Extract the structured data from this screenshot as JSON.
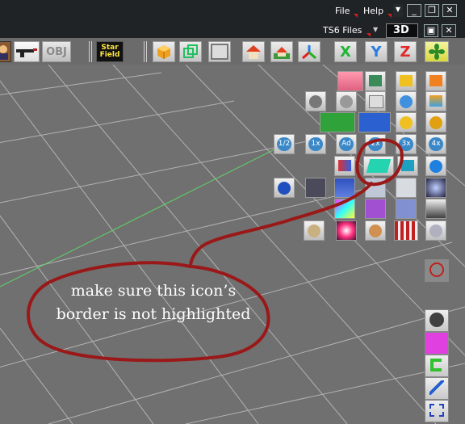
{
  "menubar": {
    "file_label": "File",
    "help_label": "Help",
    "files_dropdown": "TS6 Files",
    "view_mode": "3D"
  },
  "toolbar": {
    "obj_label": "OBJ",
    "starfield_label": "Star Field",
    "axis_labels": [
      "X",
      "Y",
      "Z"
    ]
  },
  "palette": {
    "rows": [
      {
        "icons": [
          "pink-arrow-icon",
          "p-cube-icon",
          "yellow-cubes-icon",
          "orange-cubes-icon"
        ]
      },
      {
        "icons": [
          "sphere-grid-icon",
          "cube-grid-icon",
          "cube-white-icon",
          "blue-sphere-icon",
          "gradient-cube-icon"
        ]
      },
      {
        "icons": [
          "green-shape-icon",
          "blue-shape-icon",
          "yellow-dome-icon",
          "torus-icon"
        ]
      },
      {
        "scale_labels": [
          "1/2",
          "1x",
          "Ad",
          "2x",
          "3x",
          "4x"
        ]
      },
      {
        "icons": [
          "shape-mix-icon",
          "teal-square-icon",
          "teal-cube-icon",
          "blue-sphere-ball-icon"
        ]
      },
      {
        "icons": [
          "no-sphere-icon",
          "swirl-icon",
          "blue-blob-icon",
          "cloud-icon",
          "snowflake-icon",
          "nebula-icon"
        ]
      },
      {
        "icons": [
          "gradient-texture-icon",
          "purple-texture-icon",
          "blue-texture-icon",
          "gray-gradient-icon"
        ]
      },
      {
        "icons": [
          "chrome-sphere-icon",
          "flare-icon",
          "glass-sphere-icon",
          "red-pillars-icon",
          "disc-icon"
        ]
      }
    ]
  },
  "sidebar": {
    "icons": [
      "no-light-icon",
      "sphere-tool-icon",
      "magenta-shape-icon",
      "green-c-icon",
      "wand-icon",
      "arrow-target-icon"
    ]
  },
  "annotation": {
    "text": "make sure this icon’s border is not highlighted",
    "color": "#9a1818"
  },
  "colors": {
    "titlebar": "#1f2326",
    "viewport": "#707070",
    "grid": "#c8c8c8",
    "axis_green": "#62c96a"
  }
}
